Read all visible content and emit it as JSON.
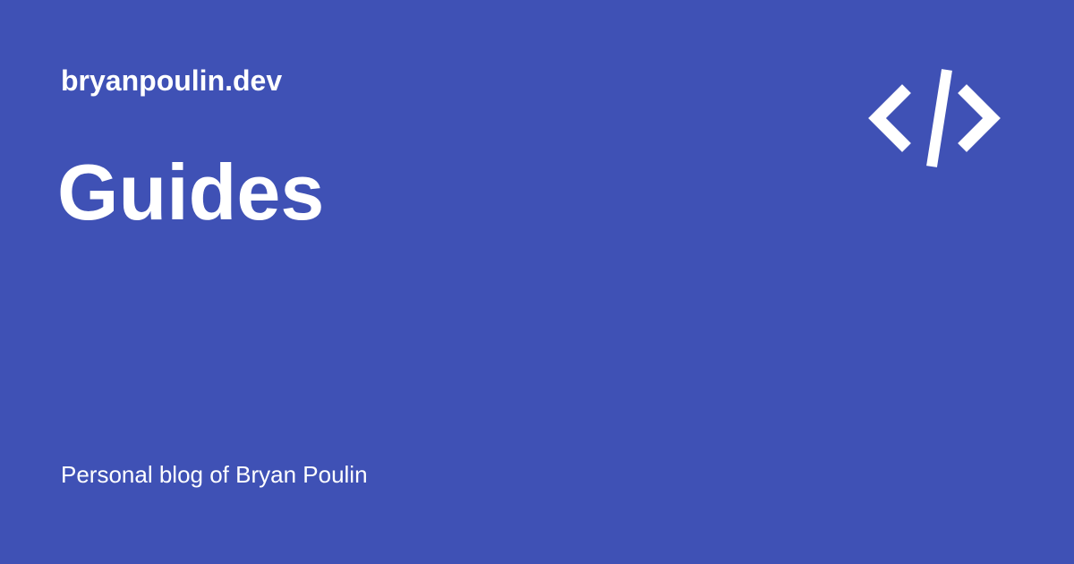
{
  "card": {
    "site_name": "bryanpoulin.dev",
    "page_title": "Guides",
    "tagline": "Personal blog of Bryan Poulin",
    "icon": "code-icon"
  },
  "colors": {
    "background": "#3f51b5",
    "text": "#ffffff"
  }
}
